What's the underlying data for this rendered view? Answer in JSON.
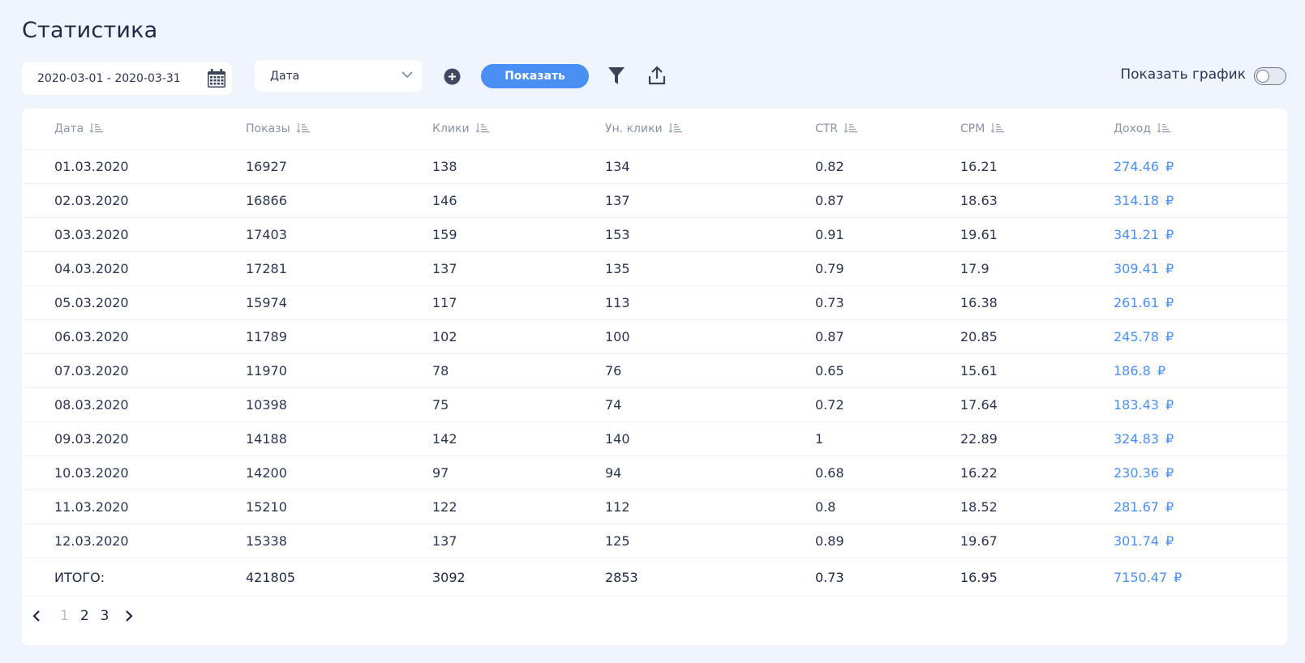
{
  "title": "Статистика",
  "toolbar": {
    "date_range": "2020-03-01 - 2020-03-31",
    "group_by": "Дата",
    "show_button": "Показать",
    "toggle_label": "Показать график",
    "toggle_on": false
  },
  "table": {
    "headers": [
      "Дата",
      "Показы",
      "Клики",
      "Ун. клики",
      "CTR",
      "CPM",
      "Доход"
    ],
    "currency_symbol": "₽",
    "rows": [
      [
        "01.03.2020",
        "16927",
        "138",
        "134",
        "0.82",
        "16.21",
        "274.46"
      ],
      [
        "02.03.2020",
        "16866",
        "146",
        "137",
        "0.87",
        "18.63",
        "314.18"
      ],
      [
        "03.03.2020",
        "17403",
        "159",
        "153",
        "0.91",
        "19.61",
        "341.21"
      ],
      [
        "04.03.2020",
        "17281",
        "137",
        "135",
        "0.79",
        "17.9",
        "309.41"
      ],
      [
        "05.03.2020",
        "15974",
        "117",
        "113",
        "0.73",
        "16.38",
        "261.61"
      ],
      [
        "06.03.2020",
        "11789",
        "102",
        "100",
        "0.87",
        "20.85",
        "245.78"
      ],
      [
        "07.03.2020",
        "11970",
        "78",
        "76",
        "0.65",
        "15.61",
        "186.8"
      ],
      [
        "08.03.2020",
        "10398",
        "75",
        "74",
        "0.72",
        "17.64",
        "183.43"
      ],
      [
        "09.03.2020",
        "14188",
        "142",
        "140",
        "1",
        "22.89",
        "324.83"
      ],
      [
        "10.03.2020",
        "14200",
        "97",
        "94",
        "0.68",
        "16.22",
        "230.36"
      ],
      [
        "11.03.2020",
        "15210",
        "122",
        "112",
        "0.8",
        "18.52",
        "281.67"
      ],
      [
        "12.03.2020",
        "15338",
        "137",
        "125",
        "0.89",
        "19.67",
        "301.74"
      ]
    ],
    "total": [
      "ИТОГО:",
      "421805",
      "3092",
      "2853",
      "0.73",
      "16.95",
      "7150.47"
    ]
  },
  "pagination": {
    "pages": [
      "1",
      "2",
      "3"
    ],
    "current": "1"
  },
  "colors": {
    "accent": "#4a8ff3",
    "background": "#f0f5fd",
    "text": "#2b3550",
    "muted": "#8a93a6"
  }
}
